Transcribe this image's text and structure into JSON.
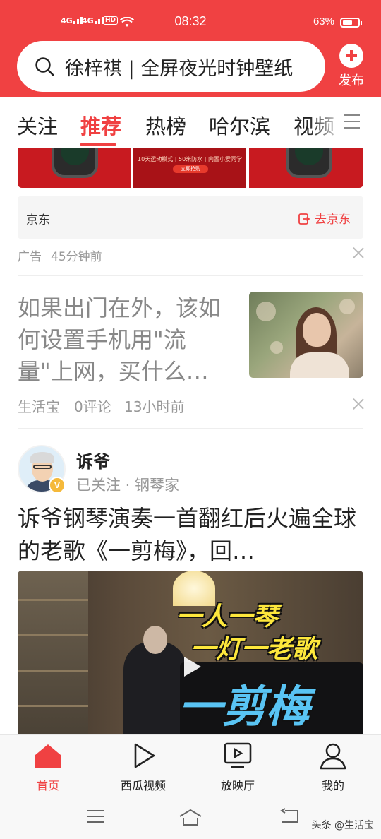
{
  "status_bar": {
    "signal1": "4G",
    "signal2": "4G",
    "hd": "HD",
    "time": "08:32",
    "battery_text": "63%",
    "battery_level": 0.63
  },
  "header": {
    "search_query": "徐梓祺 | 全屏夜光时钟壁纸",
    "publish_label": "发布"
  },
  "tabs": [
    {
      "label": "关注",
      "active": false
    },
    {
      "label": "推荐",
      "active": true
    },
    {
      "label": "热榜",
      "active": false
    },
    {
      "label": "哈尔滨",
      "active": false
    },
    {
      "label": "视频",
      "active": false
    }
  ],
  "ad": {
    "banner_text": "10天运动模式 | 50米防水 | 内置小爱同学",
    "banner_button": "立即抢购",
    "brand": "京东",
    "cta": "去京东",
    "label": "广告",
    "time": "45分钟前"
  },
  "article1": {
    "title": "如果出门在外，该如何设置手机用\"流量\"上网，买什么…",
    "source": "生活宝",
    "comments": "0评论",
    "time": "13小时前"
  },
  "article2": {
    "author": "诉爷",
    "author_sub": "已关注 · 钢琴家",
    "verified": "V",
    "title": "诉爷钢琴演奏一首翻红后火遍全球的老歌《一剪梅》，回…",
    "overlay_line1": "一人一琴",
    "overlay_line2": "一灯一老歌",
    "overlay_line3": "一剪梅"
  },
  "bottom_nav": [
    {
      "label": "首页",
      "icon": "home-icon",
      "active": true
    },
    {
      "label": "西瓜视频",
      "icon": "play-icon",
      "active": false
    },
    {
      "label": "放映厅",
      "icon": "screen-icon",
      "active": false
    },
    {
      "label": "我的",
      "icon": "user-icon",
      "active": false
    }
  ],
  "watermark": "头条 @生活宝",
  "colors": {
    "brand_red": "#f04142",
    "meta_gray": "#999999"
  }
}
